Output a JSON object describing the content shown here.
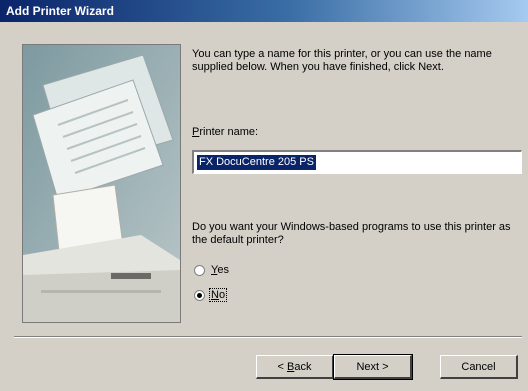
{
  "window": {
    "title": "Add Printer Wizard"
  },
  "intro": "You can type a name for this printer, or you can use the name supplied below. When you have finished, click Next.",
  "printer_name": {
    "label_accel": "P",
    "label_rest": "rinter name:",
    "value": "FX DocuCentre 205 PS"
  },
  "default_question": "Do you want your Windows-based programs to use this printer as the default printer?",
  "options": {
    "yes": {
      "accel": "Y",
      "rest": "es",
      "selected": false
    },
    "no": {
      "accel": "N",
      "rest": "o",
      "selected": true
    }
  },
  "buttons": {
    "back_pre": "< ",
    "back_accel": "B",
    "back_rest": "ack",
    "next": "Next >",
    "cancel": "Cancel"
  },
  "colors": {
    "titlebar_start": "#0a246a",
    "titlebar_end": "#a6caf0",
    "dialog_face": "#d4d0c8",
    "selection": "#0a246a"
  },
  "icons": {
    "illustration": "printer-with-documents-illustration"
  }
}
